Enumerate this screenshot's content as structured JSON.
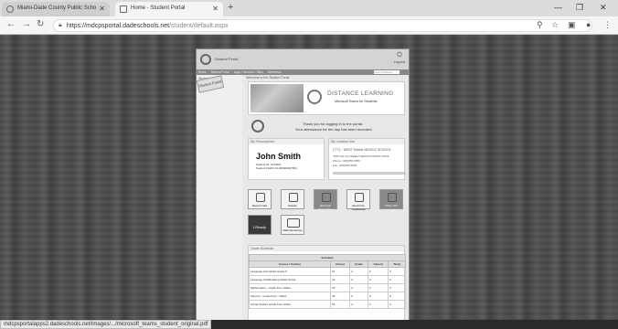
{
  "browser": {
    "tabs": [
      {
        "title": "Miami-Dade County Public Scho",
        "active": false
      },
      {
        "title": "Home - Student Portal",
        "active": true
      }
    ],
    "url_host": "https://mdcpsportal.dadeschools.net",
    "url_path": "/student/default.aspx",
    "status_url": "mdcpsportalapps2.dadeschools.net/images/.../microsoft_teams_student_original.pdf"
  },
  "portal": {
    "sticker": "Student Portal",
    "title": "Student Portal",
    "logout": "Logout",
    "nav": [
      "Home",
      "Student Portal",
      "Apps / Services / Sites",
      "Weekends"
    ],
    "search_placeholder": "Search Results",
    "sidebar": [
      "Student Pulse",
      "All Site Content"
    ],
    "welcome": "Welcome to the Student Portal",
    "banner_title": "DISTANCE LEARNING",
    "banner_sub": "Microsoft Teams for Students",
    "thanks1": "Thank you for logging in to the portal.",
    "thanks2": "Your attendance for the day has been recorded.",
    "personal_head": "My Personal Info",
    "student_name": "John Smith",
    "student_id": "Student ID: 1234567",
    "student_fleid": "Student FLEID: FL000000007654",
    "location_head": "My Location Info",
    "loc_name": "(777) - WEST MIAMI MIDDLE SCHOOL",
    "loc_addr": "7525 SW 24 STREET MIAMI FLORIDA 33155",
    "loc_phone": "Phone: (305)555-5555",
    "loc_fax": "Fax: (305)555-5556",
    "tiles": [
      "Report Card",
      "Grades",
      "Microsoft Resources",
      "Electronic Gradebook",
      "Office 365",
      "i-Ready",
      "OER Resources"
    ],
    "apps_head": "Grade Schedule",
    "table_caption": "Schedule",
    "table_headers": [
      "Course / Teacher",
      "Period",
      "Grade",
      "Absent",
      "Tardy"
    ],
    "table_rows": [
      [
        "Language Arts Gifted Grade 6",
        "01",
        "A",
        "0",
        "0"
      ],
      [
        "Language Arts/Reading Gifted Grade",
        "02",
        "A",
        "0",
        "0"
      ],
      [
        "Mathematics - Grade Four Gifted",
        "03",
        "A",
        "0",
        "0"
      ],
      [
        "Science - Grade Four - Gifted",
        "04",
        "A",
        "0",
        "0"
      ],
      [
        "Social Studies Grade Four Gifted",
        "05",
        "A",
        "0",
        "0"
      ]
    ]
  }
}
